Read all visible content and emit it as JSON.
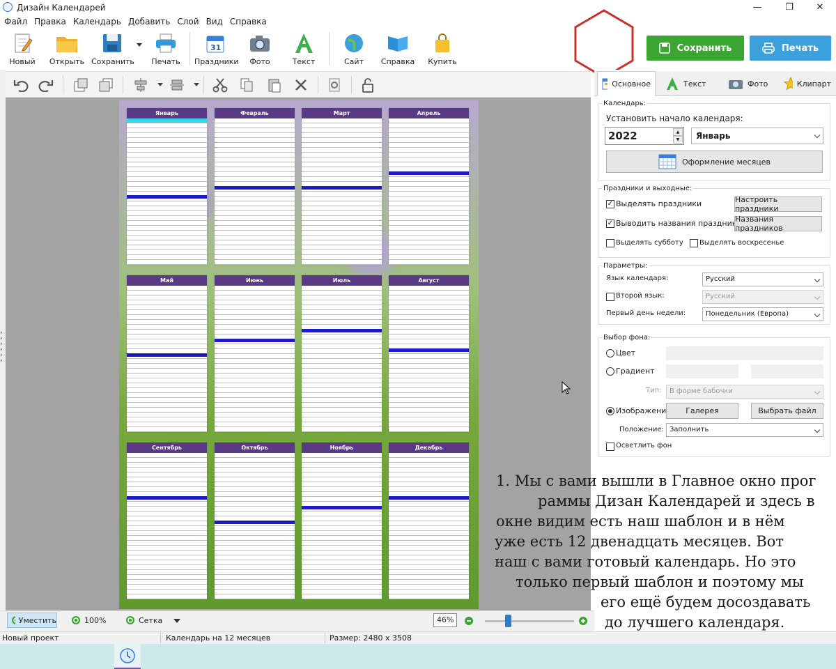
{
  "window": {
    "title": "Дизайн Календарей",
    "minimize": "—",
    "maximize": "❐",
    "close": "✕"
  },
  "menu": [
    "Файл",
    "Правка",
    "Календарь",
    "Добавить",
    "Слой",
    "Вид",
    "Справка"
  ],
  "toolbar": {
    "items": [
      "Новый",
      "Открыть",
      "Сохранить",
      "Печать",
      "Праздники",
      "Фото",
      "Текст",
      "Сайт",
      "Справка",
      "Купить"
    ],
    "save_button": "Сохранить",
    "print_button": "Печать",
    "colors": {
      "save": "#3ca632",
      "print": "#3ba0dc",
      "hexagon": "#c9302c"
    }
  },
  "poster": {
    "months": [
      "Январь",
      "Февраль",
      "Март",
      "Апрель",
      "Май",
      "Июнь",
      "Июль",
      "Август",
      "Сентябрь",
      "Октябрь",
      "Ноябрь",
      "Декабрь"
    ]
  },
  "tabs": [
    "Основное",
    "Текст",
    "Фото",
    "Клипарт"
  ],
  "calendar_group": {
    "title": "Календарь:",
    "start_label": "Установить начало календаря:",
    "year": "2022",
    "month": "Январь",
    "months_design_button": "Оформление месяцев"
  },
  "holidays_group": {
    "title": "Праздники и выходные:",
    "highlight_holidays": "Выделять праздники",
    "configure_holidays": "Настроить праздники",
    "show_holiday_names": "Выводить названия праздников",
    "holiday_names_button": "Названия праздников",
    "highlight_saturday": "Выделять субботу",
    "highlight_sunday": "Выделять воскресенье"
  },
  "params_group": {
    "title": "Параметры:",
    "language_label": "Язык календаря:",
    "language_value": "Русский",
    "second_language_label": "Второй язык:",
    "second_language_value": "Русский",
    "first_day_label": "Первый день недели:",
    "first_day_value": "Понедельник (Европа)"
  },
  "background_group": {
    "title": "Выбор фона:",
    "color": "Цвет",
    "gradient": "Градиент",
    "type_label": "Тип:",
    "type_value": "В форме бабочки",
    "image": "Изображение",
    "gallery_button": "Галерея",
    "choose_file_button": "Выбрать файл",
    "position_label": "Положение:",
    "position_value": "Заполнить",
    "lighten": "Осветлить фон"
  },
  "bottom": {
    "fit": "Уместить",
    "zoom100": "100%",
    "grid": "Сетка",
    "zoom_value": "46%"
  },
  "status": {
    "project": "Новый проект",
    "calendar": "Календарь на 12 месяцев",
    "size": "Размер: 2480 x 3508"
  },
  "annotation": [
    "1. Мы с вами вышли в Главное окно прог",
    "раммы Дизан Календарей и здесь в",
    "окне видим  есть наш шаблон и в нём",
    "уже есть 12  двенадцать месяцев. Вот",
    "наш с вами   готовый календарь. Но это",
    "только первый шаблон и поэтому мы",
    "его ещё будем досоздавать",
    "до лучшего календаря."
  ]
}
